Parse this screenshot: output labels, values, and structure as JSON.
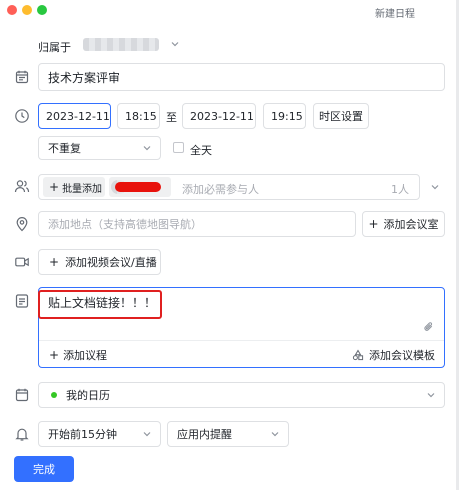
{
  "window": {
    "title": "新建日程"
  },
  "belongs": {
    "label": "归属于"
  },
  "title_field": {
    "value": "技术方案评审"
  },
  "time": {
    "start_date": "2023-12-11",
    "start_time": "18:15",
    "separator": "至",
    "end_date": "2023-12-11",
    "end_time": "19:15",
    "timezone_button": "时区设置"
  },
  "repeat": {
    "selected": "不重复",
    "all_day_label": "全天"
  },
  "attendees": {
    "bulk_add_label": "批量添加",
    "placeholder": "添加必需参与人",
    "count": "1人"
  },
  "location": {
    "placeholder": "添加地点（支持高德地图导航）",
    "add_room_label": "添加会议室"
  },
  "video": {
    "add_label": "添加视频会议/直播"
  },
  "description": {
    "value": "贴上文档链接！！！",
    "add_agenda_label": "添加议程",
    "add_template_label": "添加会议模板"
  },
  "calendar": {
    "selected": "我的日历",
    "color": "#34c724"
  },
  "reminder": {
    "time_selected": "开始前15分钟",
    "method_selected": "应用内提醒"
  },
  "footer": {
    "done_label": "完成"
  },
  "colors": {
    "accent": "#3370ff",
    "annotation": "#e02020"
  }
}
